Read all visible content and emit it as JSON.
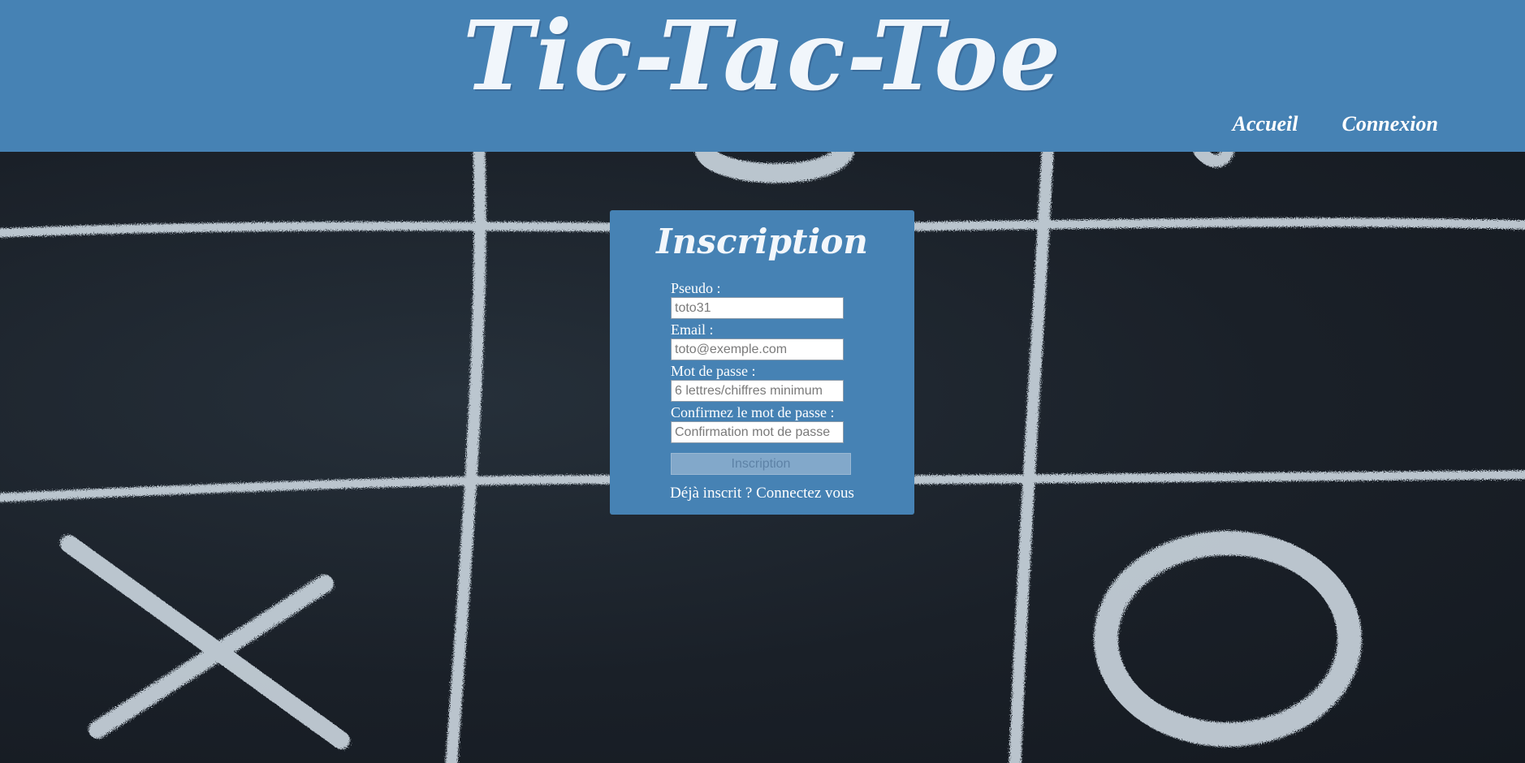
{
  "header": {
    "title": "Tic-Tac-Toe",
    "nav": [
      {
        "label": "Accueil"
      },
      {
        "label": "Connexion"
      }
    ]
  },
  "signup": {
    "title": "Inscription",
    "fields": {
      "pseudo": {
        "label": "Pseudo :",
        "placeholder": "toto31"
      },
      "email": {
        "label": "Email :",
        "placeholder": "toto@exemple.com"
      },
      "password": {
        "label": "Mot de passe :",
        "placeholder": "6 lettres/chiffres minimum"
      },
      "confirm": {
        "label": "Confirmez le mot de passe :",
        "placeholder": "Confirmation mot de passe"
      }
    },
    "submit_label": "Inscription",
    "login_link": "Déjà inscrit ? Connectez vous"
  },
  "colors": {
    "accent": "#4682b4",
    "chalk": "#c8d3dc",
    "board": "#1b2027"
  },
  "background": {
    "marks": [
      "X",
      "O",
      "O"
    ]
  }
}
